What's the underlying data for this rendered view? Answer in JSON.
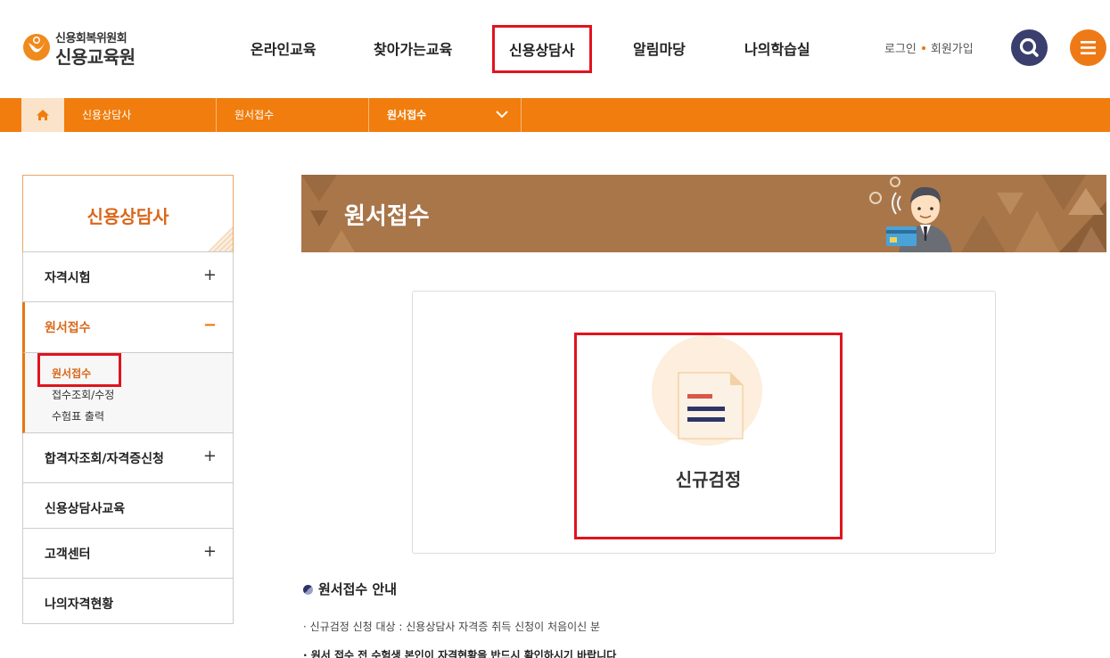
{
  "header": {
    "logo": {
      "line1": "신용회복위원회",
      "line2": "신용교육원"
    },
    "nav": [
      {
        "label": "온라인교육"
      },
      {
        "label": "찾아가는교육"
      },
      {
        "label": "신용상담사"
      },
      {
        "label": "알림마당"
      },
      {
        "label": "나의학습실"
      }
    ],
    "util": {
      "login": "로그인",
      "join": "회원가입"
    },
    "icons": {
      "search": "search-icon",
      "menu": "hamburger-menu-icon"
    },
    "colors": {
      "search_bg": "#3a3f6e",
      "menu_bg": "#ee7a17"
    }
  },
  "locbar": {
    "home_icon": "home-icon",
    "items": [
      {
        "label": "신용상담사"
      },
      {
        "label": "원서접수"
      },
      {
        "label": "원서접수"
      }
    ],
    "color": "#f07d0d"
  },
  "sidebar": {
    "title": "신용상담사",
    "items": [
      {
        "label": "자격시험",
        "sign": "+"
      },
      {
        "label": "원서접수",
        "sign": "−"
      },
      {
        "label": "합격자조회/자격증신청",
        "sign": "+"
      },
      {
        "label": "신용상담사교육",
        "sign": ""
      },
      {
        "label": "고객센터",
        "sign": "+"
      },
      {
        "label": "나의자격현황",
        "sign": ""
      }
    ],
    "sub_items": [
      {
        "label": "원서접수"
      },
      {
        "label": "접수조회/수정"
      },
      {
        "label": "수험표 출력"
      }
    ]
  },
  "banner": {
    "title": "원서접수"
  },
  "card": {
    "choice_label": "신규검정",
    "icon": "document-icon"
  },
  "guide": {
    "title": "원서접수 안내",
    "lines": [
      "· 신규검정 신청 대상 : 신용상담사 자격증 취득 신청이 처음이신 분",
      "· 원서 접수 전 수험생 본인이 자격현황을 반드시 확인하시기 바랍니다"
    ]
  }
}
